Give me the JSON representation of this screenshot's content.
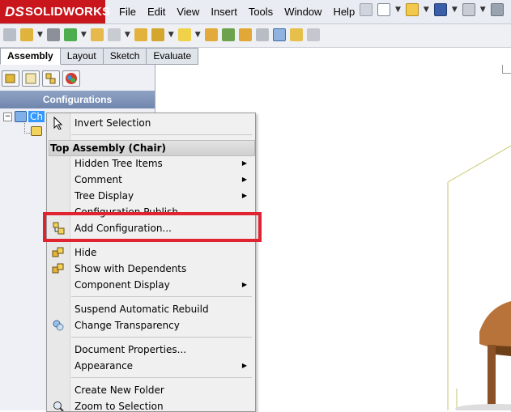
{
  "app": {
    "name": "SOLIDWORKS",
    "logo_mark": "DS"
  },
  "menu": [
    "File",
    "Edit",
    "View",
    "Insert",
    "Tools",
    "Window",
    "Help"
  ],
  "toolbar_icons": [
    "pin-icon",
    "new-document-icon",
    "open-icon",
    "save-icon",
    "print-icon",
    "options-icon"
  ],
  "assembly_toolbar_icons": [
    "insert-component-icon",
    "mate-icon",
    "component-pattern-icon",
    "smart-fasteners-icon",
    "move-component-icon",
    "show-hidden-icon",
    "assembly-features-icon",
    "reference-geometry-icon",
    "new-motion-study-icon",
    "bill-of-materials-icon",
    "exploded-view-icon",
    "explode-line-sketch-icon",
    "interference-detection-icon",
    "clearance-verification-icon",
    "hole-alignment-icon"
  ],
  "command_tabs": [
    "Assembly",
    "Layout",
    "Sketch",
    "Evaluate"
  ],
  "panel": {
    "manager_icons": [
      "feature-manager-icon",
      "property-manager-icon",
      "configuration-manager-icon",
      "display-manager-icon"
    ],
    "header": "Configurations",
    "tree_root_label": "Ch"
  },
  "context_menu": {
    "top_item": "Invert Selection",
    "group_header": "Top Assembly (Chair)",
    "items": [
      {
        "label": "Hidden Tree Items",
        "submenu": true
      },
      {
        "label": "Comment",
        "submenu": true
      },
      {
        "label": "Tree Display",
        "submenu": true
      },
      {
        "label": "Configuration Publish...",
        "submenu": false
      },
      {
        "label": "Add Configuration...",
        "submenu": false
      },
      {
        "label": "Hide",
        "submenu": false
      },
      {
        "label": "Show with Dependents",
        "submenu": false
      },
      {
        "label": "Component Display",
        "submenu": true
      },
      {
        "label": "Suspend Automatic Rebuild",
        "submenu": false
      },
      {
        "label": "Change Transparency",
        "submenu": false
      },
      {
        "label": "Document Properties...",
        "submenu": false
      },
      {
        "label": "Appearance",
        "submenu": true
      },
      {
        "label": "Create New Folder",
        "submenu": false
      },
      {
        "label": "Zoom to Selection",
        "submenu": false
      }
    ],
    "submenu_glyph": "▶"
  },
  "colors": {
    "brand": "#c9161d",
    "selection": "#3399ff",
    "highlight_box": "#e02330",
    "chair_wood": "#b8733a"
  }
}
